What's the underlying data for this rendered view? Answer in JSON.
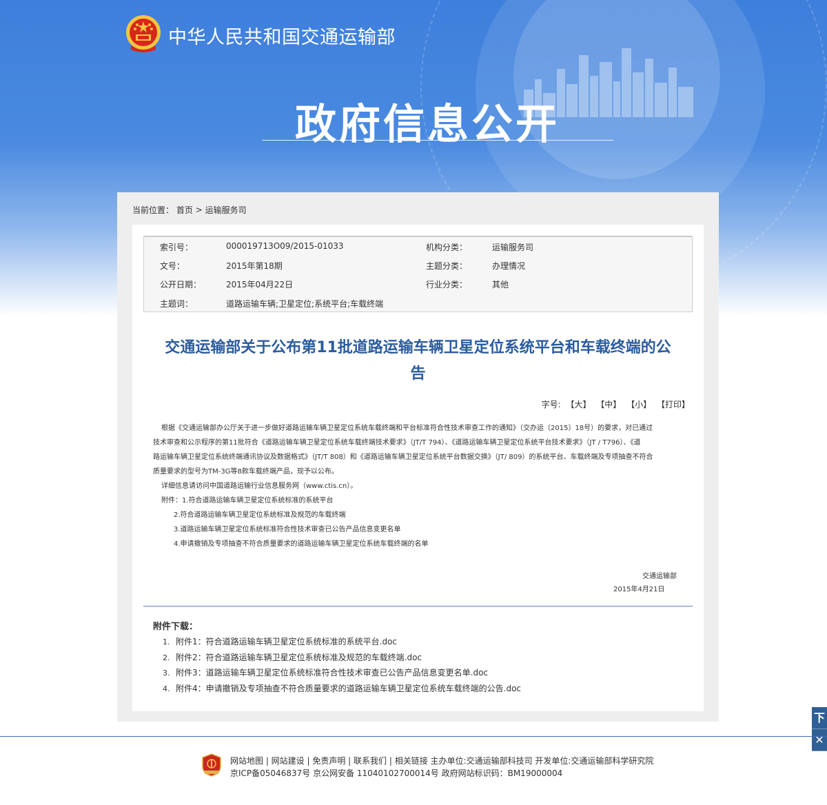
{
  "header": {
    "ministry_name": "中华人民共和国交通运输部",
    "banner_title": "政府信息公开"
  },
  "breadcrumb": {
    "prefix": "当前位置：",
    "home": "首页",
    "separator": ">",
    "current": "运输服务司"
  },
  "meta": {
    "index_no_label": "索引号：",
    "index_no": "000019713O09/2015-01033",
    "org_label": "机构分类：",
    "org": "运输服务司",
    "doc_no_label": "文号：",
    "doc_no": "2015年第18期",
    "topic_label": "主题分类：",
    "topic": "办理情况",
    "date_label": "公开日期：",
    "date": "2015年04月22日",
    "industry_label": "行业分类：",
    "industry": "其他",
    "keywords_label": "主题词：",
    "keywords": "道路运输车辆;卫星定位;系统平台;车载终端"
  },
  "article": {
    "title_line1": "交通运输部关于公布第11批道路运输车辆卫星定位系统平台和车载终端的公",
    "title_line2": "告",
    "font_label": "字号:",
    "font_large": "【大】",
    "font_medium": "【中】",
    "font_small": "【小】",
    "print": "【打印】",
    "para1_l1": "根据《交通运输部办公厅关于进一步做好道路运输车辆卫星定位系统车载终端和平台标准符合性技术审查工作的通知》（交办运〔2015〕18号）的要求，对已通过",
    "para1_l2": "技术审查和公示程序的第11批符合《道路运输车辆卫星定位系统车载终端技术要求》（JT/T 794）、《道路运输车辆卫星定位系统平台技术要求》（JT / T796）、《道",
    "para1_l3": "路运输车辆卫星定位系统终端通讯协议及数据格式》（JT/T 808）和《道路运输车辆卫星定位系统平台数据交换》（JT/ 809）的系统平台、车载终端及专项抽查不符合",
    "para1_l4": "质量要求的型号为TM-3G等8款车载终端产品，现予以公布。",
    "para2": "详细信息请访问中国道路运输行业信息服务网（www.ctis.cn）。",
    "attach1": "附件：1.符合道路运输车辆卫星定位系统标准的系统平台",
    "attach2": "2.符合道路运输车辆卫星定位系统标准及规范的车载终端",
    "attach3": "3.道路运输车辆卫星定位系统标准符合性技术审查已公告产品信息变更名单",
    "attach4": "4.申请撤销及专项抽查不符合质量要求的道路运输车辆卫星定位系统车载终端的名单",
    "signature": "交通运输部",
    "sign_date": "2015年4月21日"
  },
  "downloads": {
    "title": "附件下载：",
    "items": [
      {
        "num": "1.",
        "label": "附件1：符合道路运输车辆卫星定位系统标准的系统平台.doc"
      },
      {
        "num": "2.",
        "label": "附件2：符合道路运输车辆卫星定位系统标准及规范的车载终端.doc"
      },
      {
        "num": "3.",
        "label": "附件3：道路运输车辆卫星定位系统标准符合性技术审查已公告产品信息变更名单.doc"
      },
      {
        "num": "4.",
        "label": "附件4：申请撤销及专项抽查不符合质量要求的道路运输车辆卫星定位系统车载终端的公告.doc"
      }
    ]
  },
  "side_widget": {
    "top_glyph": "下",
    "close_glyph": "✕"
  },
  "footer": {
    "links": "网站地图 | 网站建设 | 免责声明 | 联系我们 | 相关链接",
    "sponsor": "主办单位:交通运输部科技司 开发单位:交通运输部科学研究院",
    "icp": "京ICP备05046837号",
    "police": "京公网安备 11040102700014号",
    "site_id": "政府网站标识码：BM19000004",
    "logo_text": "党政机关"
  },
  "colors": {
    "banner_blue": "#3e7fdc",
    "title_blue": "#2c5c9e",
    "emblem_red": "#d9261c",
    "emblem_gold": "#f5c542",
    "footer_blue": "#3e6db3"
  }
}
